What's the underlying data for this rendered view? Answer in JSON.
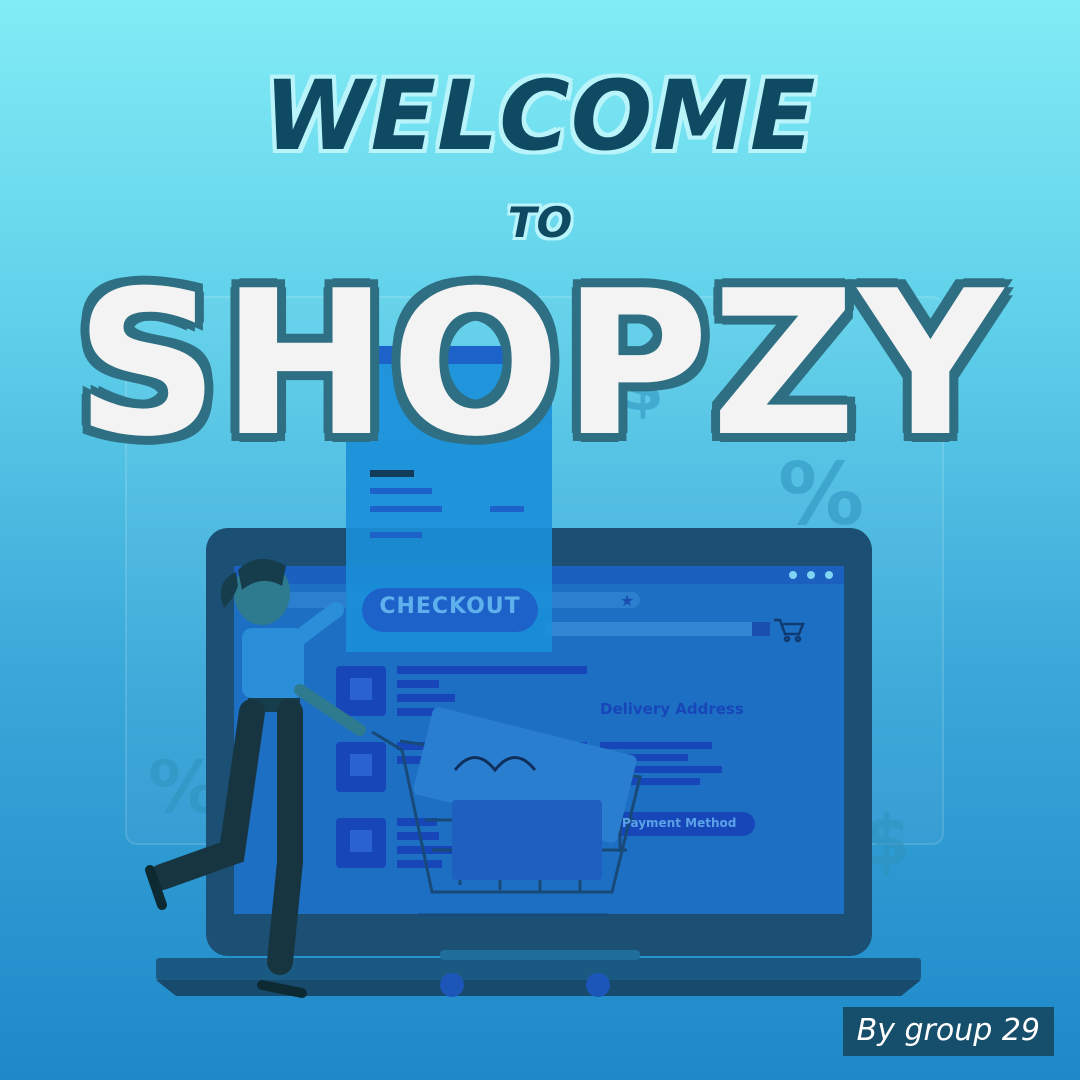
{
  "headline": {
    "welcome": "WELCOME",
    "to": "TO",
    "brand": "SHOPZY"
  },
  "screen": {
    "checkout_label": "CHECKOUT",
    "delivery_label": "Delivery Address",
    "payment_label": "Payment Method"
  },
  "background_symbols": {
    "percent": "%",
    "dollar": "$"
  },
  "byline": "By group 29",
  "colors": {
    "title_dark": "#0f4a63",
    "brand_fill": "#f3f3f3",
    "brand_outline": "#2f6f83",
    "byline_bg": "#164f6b"
  }
}
